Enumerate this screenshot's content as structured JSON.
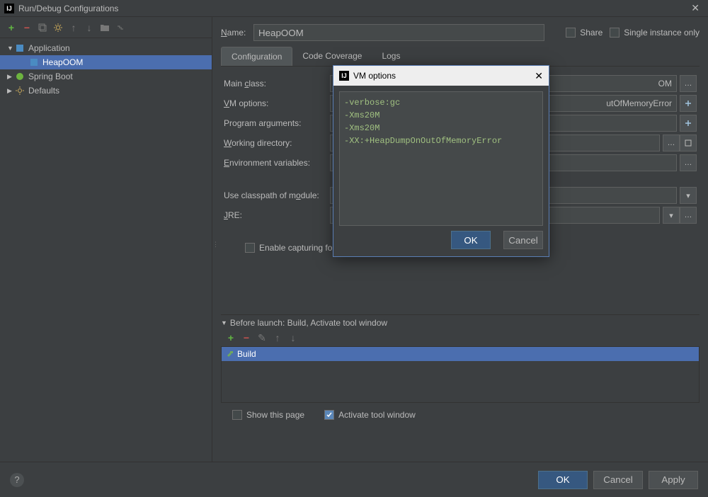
{
  "window": {
    "title": "Run/Debug Configurations"
  },
  "sidebar": {
    "items": [
      {
        "label": "Application",
        "icon": "application-icon"
      },
      {
        "label": "HeapOOM",
        "icon": "application-icon"
      },
      {
        "label": "Spring Boot",
        "icon": "spring-icon"
      },
      {
        "label": "Defaults",
        "icon": "wrench-icon"
      }
    ]
  },
  "form": {
    "nameLabel_pre": "N",
    "nameLabel_post": "ame:",
    "nameValue": "HeapOOM",
    "shareLabel": "Share",
    "singleInstanceLabel": "Single instance only"
  },
  "tabs": {
    "configuration": "Configuration",
    "codeCoverage": "Code Coverage",
    "logs": "Logs"
  },
  "config": {
    "mainClass_pre": "Main ",
    "mainClass_ul": "c",
    "mainClass_post": "lass:",
    "vmOptions_ul": "V",
    "vmOptions_post": "M options:",
    "progArgs_pre": "Pro",
    "progArgs_ul": "g",
    "progArgs_post": "ram arguments:",
    "workDir_ul": "W",
    "workDir_post": "orking directory:",
    "envVars_ul": "E",
    "envVars_post": "nvironment variables:",
    "classpath_pre": "Use classpath of m",
    "classpath_ul": "o",
    "classpath_post": "dule:",
    "jre_ul": "J",
    "jre_post": "RE:",
    "enableCapture": "Enable capturing form",
    "mainClassStub": "OM",
    "vmOptionsStub": "utOfMemoryError"
  },
  "beforeLaunch": {
    "header_ul": "B",
    "header_post": "efore launch: Build, Activate tool window",
    "buildItem": "Build",
    "showThisPage": "Show this page",
    "activateToolWindow": "Activate tool window"
  },
  "modal": {
    "title": "VM options",
    "text": "-verbose:gc\n-Xms20M\n-Xms20M\n-XX:+HeapDumpOnOutOfMemoryError",
    "ok": "OK",
    "cancel": "Cancel"
  },
  "buttons": {
    "ok": "OK",
    "cancel": "Cancel",
    "apply": "Apply"
  }
}
